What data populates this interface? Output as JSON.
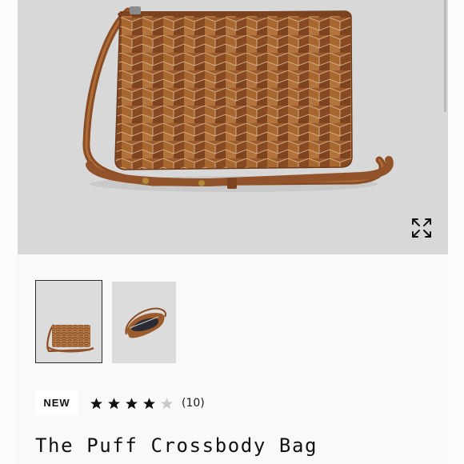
{
  "product": {
    "title": "The Puff Crossbody Bag",
    "badge": "NEW",
    "rating": {
      "stars": 4,
      "max_stars": 5,
      "count_text": "(10)"
    }
  },
  "gallery": {
    "images": [
      {
        "name": "bag-front-view",
        "selected": true
      },
      {
        "name": "bag-interior-view",
        "selected": false
      }
    ],
    "expand_icon": "expand-arrows-icon"
  },
  "colors": {
    "leather": "#9a5a2c",
    "background": "#d8d8d8",
    "star_filled": "#111111",
    "star_empty": "#c8c8c8"
  }
}
